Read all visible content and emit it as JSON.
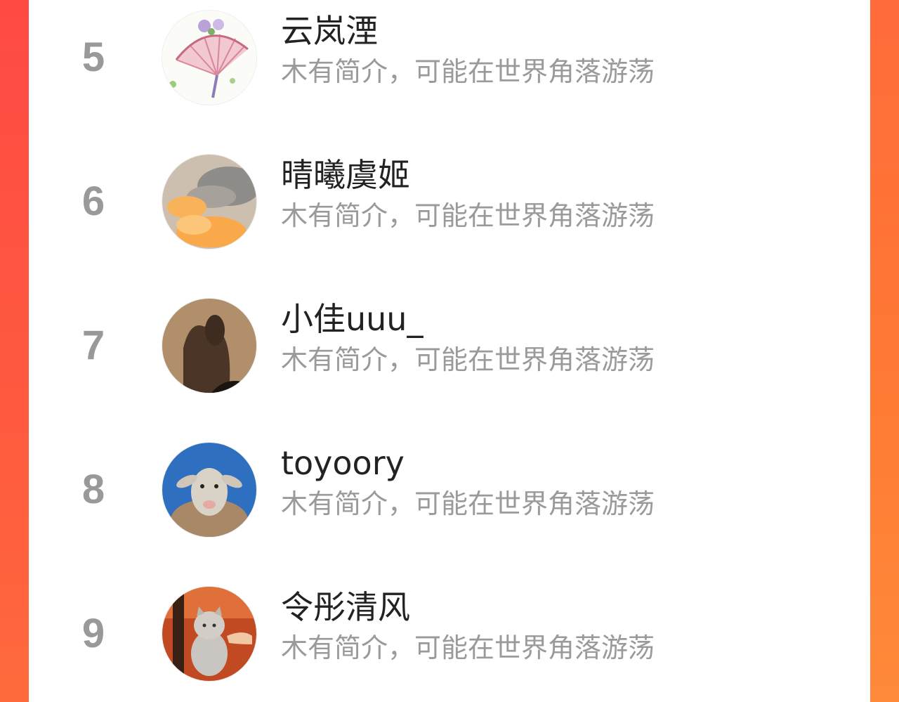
{
  "colors": {
    "accent_left": "#ff4a44",
    "accent_right": "#ff7a34",
    "rank": "#999999",
    "name": "#222222",
    "bio": "#9a9a9a"
  },
  "users": [
    {
      "rank": "5",
      "name": "云岚湮",
      "bio": "木有简介，可能在世界角落游荡",
      "avatar": "folding-fan-flowers-avatar"
    },
    {
      "rank": "6",
      "name": "晴曦虞姬",
      "bio": "木有简介，可能在世界角落游荡",
      "avatar": "sunset-clouds-avatar"
    },
    {
      "rank": "7",
      "name": "小佳uuu_",
      "bio": "木有简介，可能在世界角落游荡",
      "avatar": "shadow-on-curtain-avatar"
    },
    {
      "rank": "8",
      "name": "toyoory",
      "bio": "木有简介，可能在世界角落游荡",
      "avatar": "sheep-blue-sky-avatar"
    },
    {
      "rank": "9",
      "name": "令彤清风",
      "bio": "木有简介，可能在世界角落游荡",
      "avatar": "cat-held-avatar"
    }
  ]
}
